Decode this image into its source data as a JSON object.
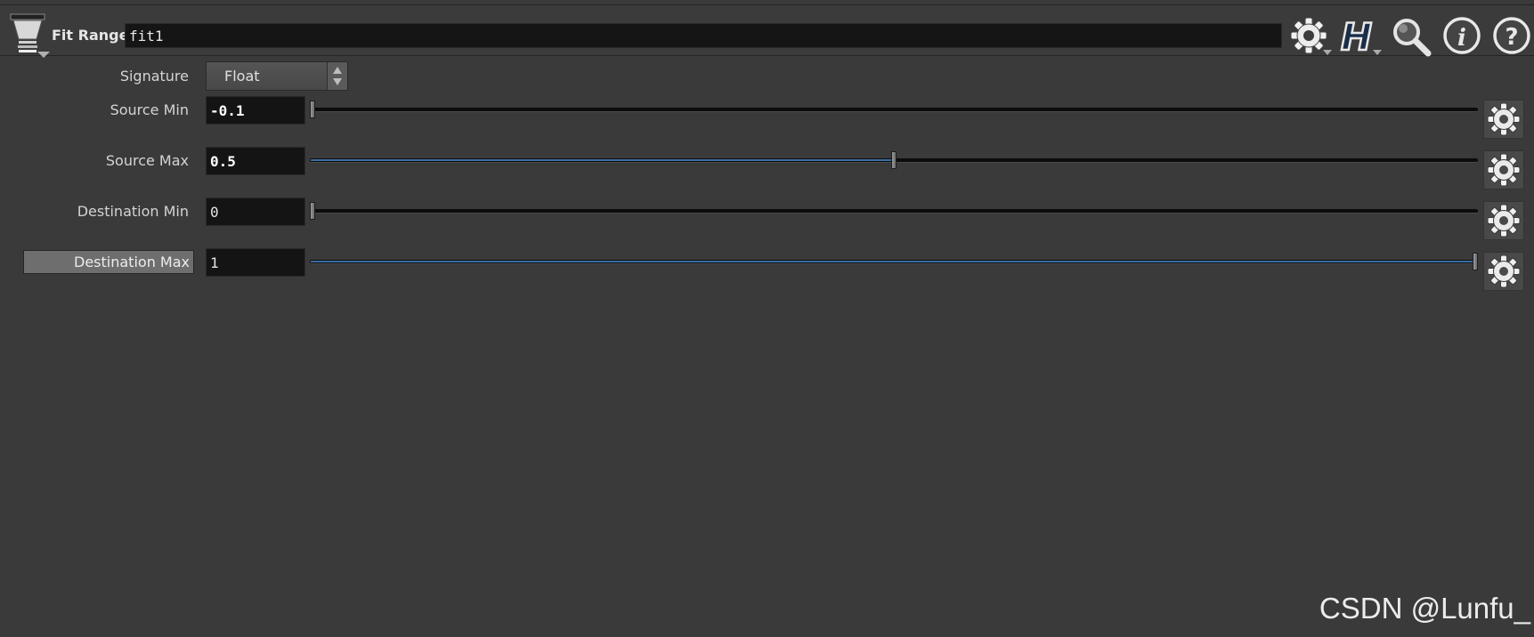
{
  "header": {
    "node_type": "Fit Range",
    "node_name": "fit1",
    "icons": [
      "node-settings-gear-icon",
      "houdini-h-icon",
      "search-icon",
      "info-icon",
      "help-icon"
    ]
  },
  "params": {
    "signature": {
      "label": "Signature",
      "value": "Float"
    },
    "source_min": {
      "label": "Source Min",
      "value": "-0.1",
      "slider_fraction": 0.0
    },
    "source_max": {
      "label": "Source Max",
      "value": "0.5",
      "slider_fraction": 0.5
    },
    "dest_min": {
      "label": "Destination Min",
      "value": "0",
      "slider_fraction": 0.0
    },
    "dest_max": {
      "label": "Destination Max",
      "value": "1",
      "slider_fraction": 1.0
    }
  },
  "colors": {
    "background": "#3a3a3a",
    "field": "#141414",
    "slider_fill": "#3b6ea6"
  },
  "watermark": "CSDN @Lunfu_"
}
